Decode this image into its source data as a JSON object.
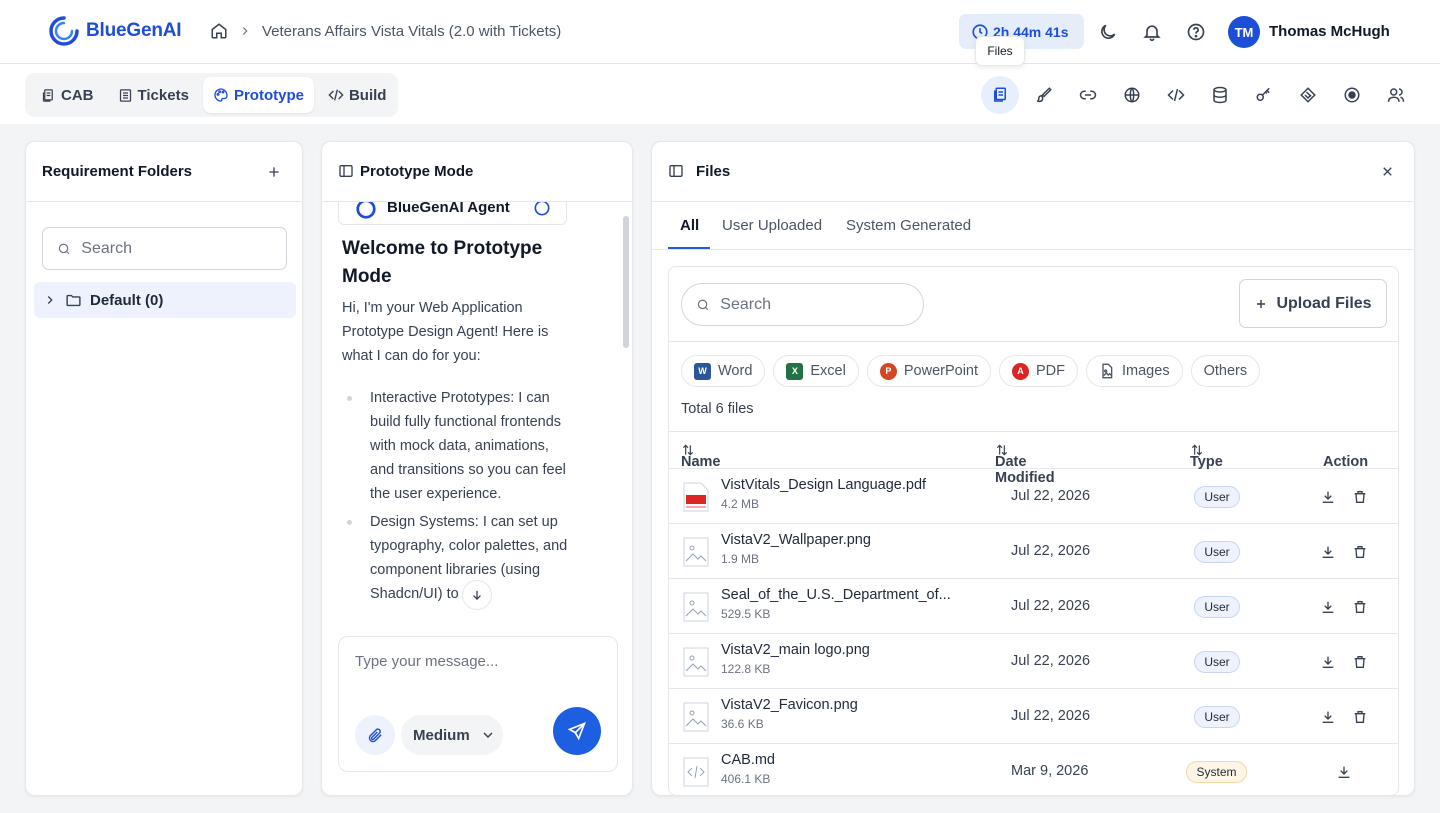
{
  "header": {
    "brand": "BlueGenAI",
    "breadcrumb_project": "Veterans Affairs Vista Vitals (2.0 with Tickets)",
    "timer": "2h 44m 41s",
    "tooltip": "Files",
    "user_initials": "TM",
    "user_name": "Thomas McHugh"
  },
  "nav_tabs": [
    {
      "label": "CAB"
    },
    {
      "label": "Tickets"
    },
    {
      "label": "Prototype"
    },
    {
      "label": "Build"
    }
  ],
  "active_tab": "Prototype",
  "requirements": {
    "title": "Requirement Folders",
    "search_placeholder": "Search",
    "folders": [
      {
        "label": "Default (0)"
      }
    ]
  },
  "chat": {
    "title": "Prototype Mode",
    "agent_name": "BlueGenAI Agent",
    "welcome_title": "Welcome to Prototype Mode",
    "intro": "Hi, I'm your Web Application Prototype Design Agent! Here is what I can do for you:",
    "bullets": [
      "Interactive Prototypes: I can build fully functional frontends with mock data, animations, and transitions so you can feel the user experience.",
      "Design Systems: I can set up typography, color palettes, and component libraries (using Shadcn/UI) to give"
    ],
    "input_placeholder": "Type your message...",
    "model": "Medium"
  },
  "files": {
    "title": "Files",
    "tabs": [
      {
        "label": "All"
      },
      {
        "label": "User Uploaded"
      },
      {
        "label": "System Generated"
      }
    ],
    "search_placeholder": "Search",
    "upload_label": "Upload Files",
    "filters": [
      {
        "label": "Word",
        "color": "#2b579a"
      },
      {
        "label": "Excel",
        "color": "#217346"
      },
      {
        "label": "PowerPoint",
        "color": "#d24726"
      },
      {
        "label": "PDF",
        "color": "#dc2626"
      },
      {
        "label": "Images",
        "color": "#6b7280"
      },
      {
        "label": "Others",
        "color": "#6b7280"
      }
    ],
    "total": "Total 6 files",
    "columns": {
      "name": "Name",
      "date": "Date Modified",
      "type": "Type",
      "action": "Action"
    },
    "rows": [
      {
        "name": "VistVitals_Design Language.pdf",
        "size": "4.2 MB",
        "date": "Jul 22, 2026",
        "type": "User",
        "kind": "pdf"
      },
      {
        "name": "VistaV2_Wallpaper.png",
        "size": "1.9 MB",
        "date": "Jul 22, 2026",
        "type": "User",
        "kind": "image"
      },
      {
        "name": "Seal_of_the_U.S._Department_of...",
        "size": "529.5 KB",
        "date": "Jul 22, 2026",
        "type": "User",
        "kind": "image"
      },
      {
        "name": "VistaV2_main logo.png",
        "size": "122.8 KB",
        "date": "Jul 22, 2026",
        "type": "User",
        "kind": "image"
      },
      {
        "name": "VistaV2_Favicon.png",
        "size": "36.6 KB",
        "date": "Jul 22, 2026",
        "type": "User",
        "kind": "image"
      },
      {
        "name": "CAB.md",
        "size": "406.1 KB",
        "date": "Mar 9, 2026",
        "type": "System",
        "kind": "code"
      }
    ]
  },
  "colors": {
    "accent": "#1d4ed8",
    "send": "#1d5fe0"
  }
}
